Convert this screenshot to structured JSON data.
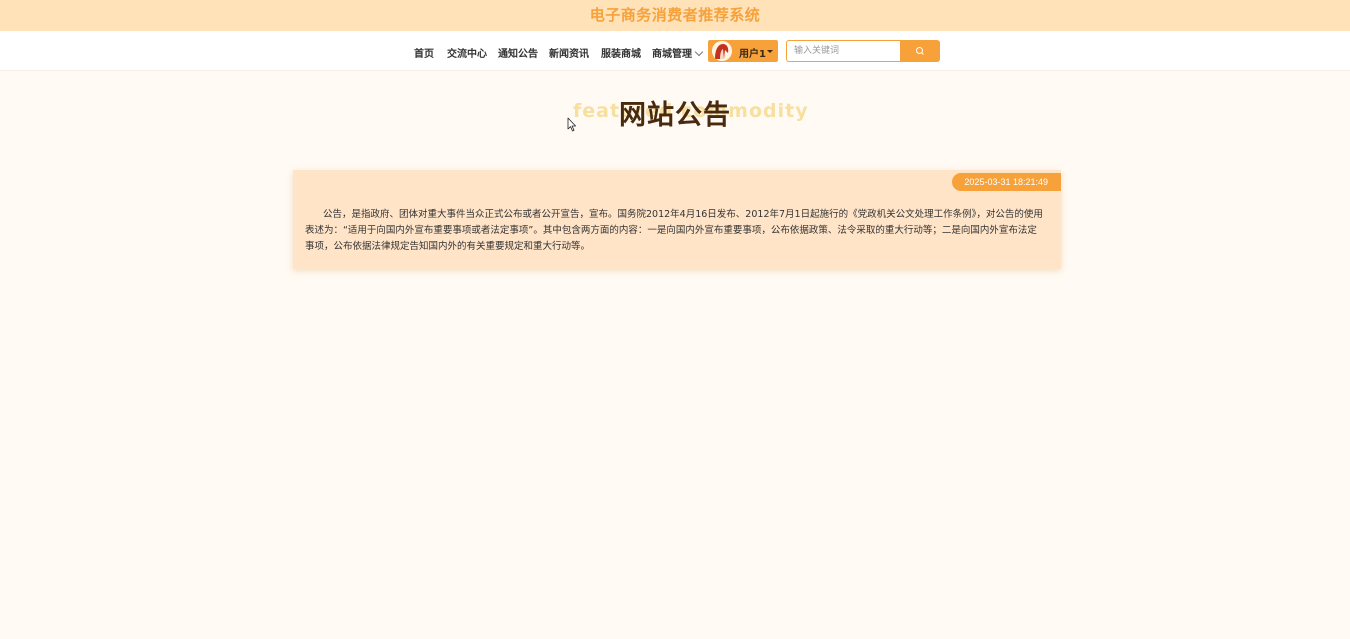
{
  "header": {
    "site_title": "电子商务消费者推荐系统"
  },
  "nav": {
    "items": [
      {
        "label": "首页"
      },
      {
        "label": "交流中心"
      },
      {
        "label": "通知公告"
      },
      {
        "label": "新闻资讯"
      },
      {
        "label": "服装商城"
      },
      {
        "label": "商城管理"
      }
    ],
    "user_label": "用户1",
    "search": {
      "placeholder": "输入关键词",
      "value": ""
    }
  },
  "page": {
    "title": "网站公告",
    "title_background_text": "featured commodity"
  },
  "notice": {
    "date": "2025-03-31 18:21:49",
    "content": "公告，是指政府、团体对重大事件当众正式公布或者公开宣告，宣布。国务院2012年4月16日发布、2012年7月1日起施行的《党政机关公文处理工作条例》，对公告的使用表述为：“适用于向国内外宣布重要事项或者法定事项”。其中包含两方面的内容：一是向国内外宣布重要事项，公布依据政策、法令采取的重大行动等；二是向国内外宣布法定事项，公布依据法律规定告知国内外的有关重要规定和重大行动等。"
  },
  "colors": {
    "accent": "#f7a13a",
    "topbar_bg": "#ffe2b8",
    "page_bg": "#fffaf3",
    "card_bg": "#ffe4c8",
    "title_text": "#4a2a0e"
  },
  "icons": {
    "search": "search-icon",
    "dropdown": "chevron-down-icon",
    "avatar": "avatar-icon",
    "cursor": "mouse-cursor-icon"
  }
}
